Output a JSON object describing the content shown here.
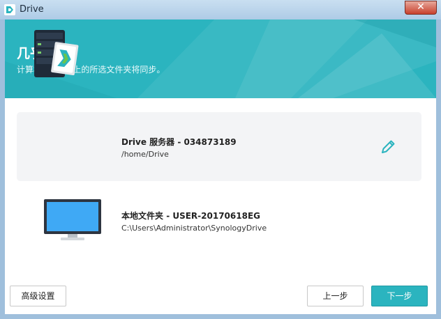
{
  "window": {
    "title": "Drive",
    "close_glyph": "✕"
  },
  "header": {
    "title": "几乎完成！",
    "subtitle": "计算机和 NAS 上的所选文件夹将同步。"
  },
  "server": {
    "name": "Drive 服务器",
    "id": " - 034873189",
    "path": "/home/Drive",
    "icon": "nas-server-icon"
  },
  "local": {
    "name": "本地文件夹",
    "id": " - USER-20170618EG",
    "path": "C:\\Users\\Administrator\\SynologyDrive",
    "icon": "monitor-icon"
  },
  "buttons": {
    "advanced": "高级设置",
    "prev": "上一步",
    "next": "下一步"
  },
  "colors": {
    "accent": "#2bb4bf",
    "card": "#f3f4f6"
  }
}
